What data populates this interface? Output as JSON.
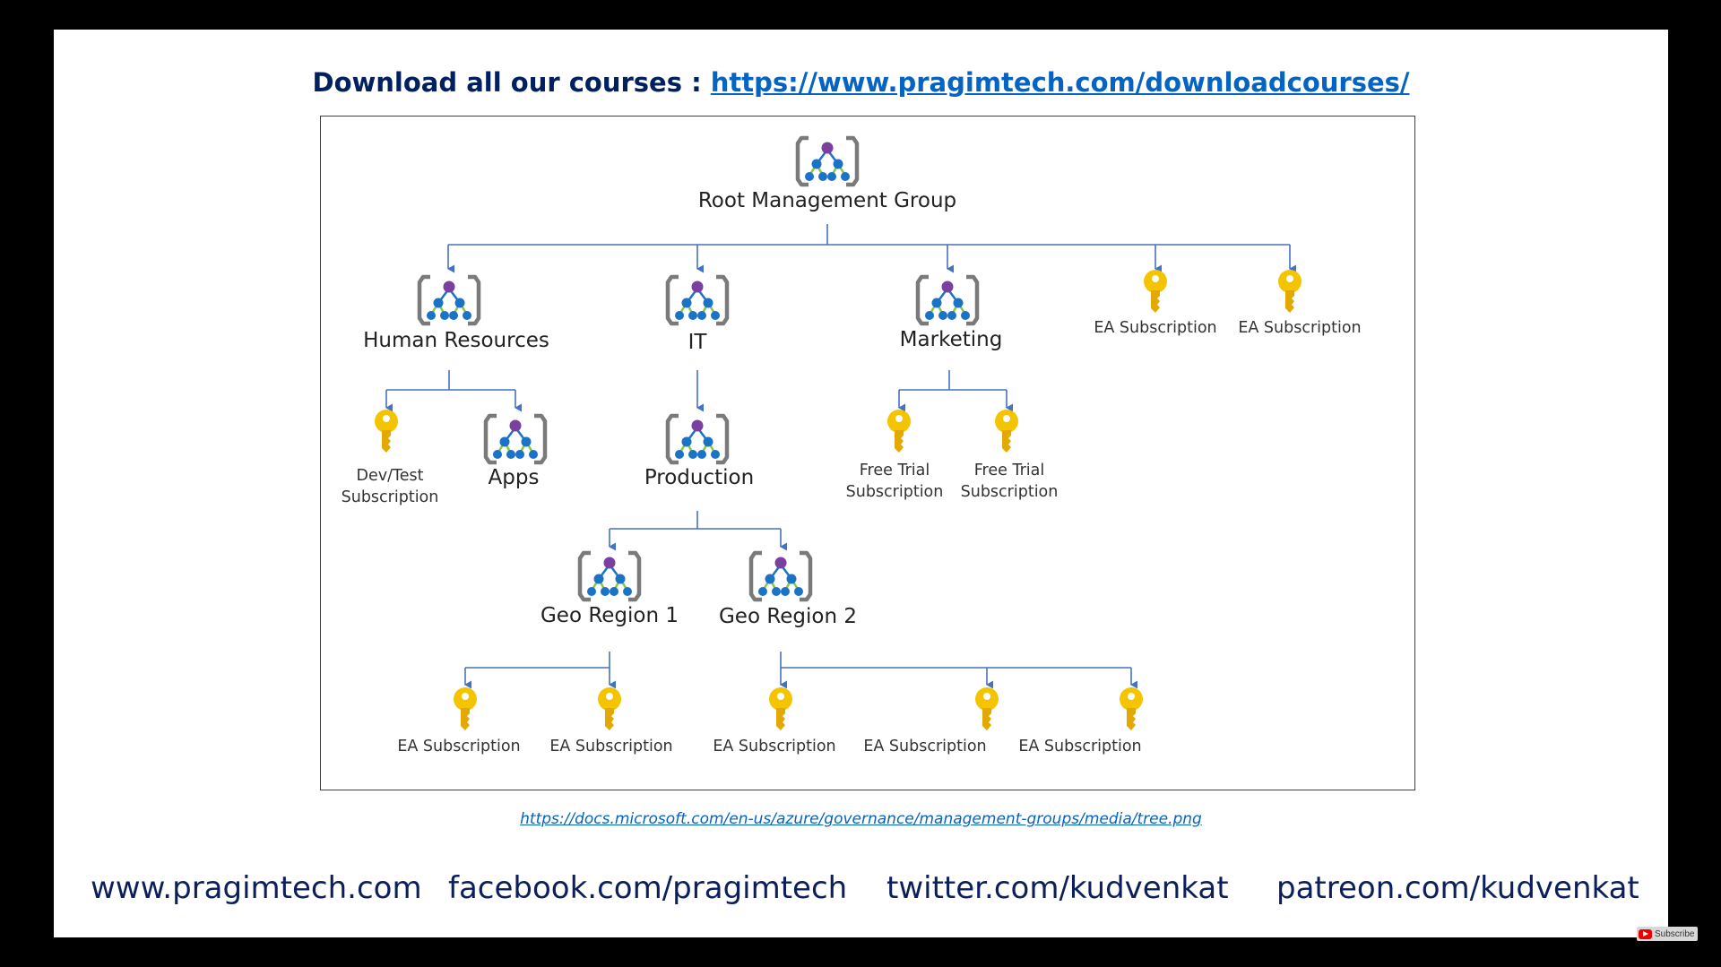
{
  "header": {
    "prefix": "Download all our courses : ",
    "link": "https://www.pragimtech.com/downloadcourses/"
  },
  "tree": {
    "root": "Root Management Group",
    "human_resources": "Human Resources",
    "it": "IT",
    "marketing": "Marketing",
    "ea_sub_top_1": "EA Subscription",
    "ea_sub_top_2": "EA Subscription",
    "devtest_line1": "Dev/Test",
    "devtest_line2": "Subscription",
    "apps": "Apps",
    "production": "Production",
    "free_trial_1_line1": "Free Trial",
    "free_trial_1_line2": "Subscription",
    "free_trial_2_line1": "Free Trial",
    "free_trial_2_line2": "Subscription",
    "geo_region_1": "Geo Region 1",
    "geo_region_2": "Geo Region 2",
    "geo1_sub_1": "EA Subscription",
    "geo1_sub_2": "EA Subscription",
    "geo2_sub_1": "EA Subscription",
    "geo2_sub_2": "EA Subscription",
    "geo2_sub_3": "EA Subscription"
  },
  "source_link": "https://docs.microsoft.com/en-us/azure/governance/management-groups/media/tree.png",
  "footer": {
    "website": "www.pragimtech.com",
    "facebook": "facebook.com/pragimtech",
    "twitter": "twitter.com/kudvenkat",
    "patreon": "patreon.com/kudvenkat"
  },
  "subscribe_label": "Subscribe",
  "colors": {
    "background": "#000000",
    "slide": "#ffffff",
    "header_text": "#002060",
    "link": "#0563c1",
    "connector": "#4472c4",
    "key_gold": "#f5c400",
    "node_purple": "#7b3fa0",
    "node_blue": "#1a73c7",
    "node_green": "#8cc63f"
  },
  "icons": {
    "management_group": "management-group-icon",
    "subscription": "subscription-key-icon"
  }
}
